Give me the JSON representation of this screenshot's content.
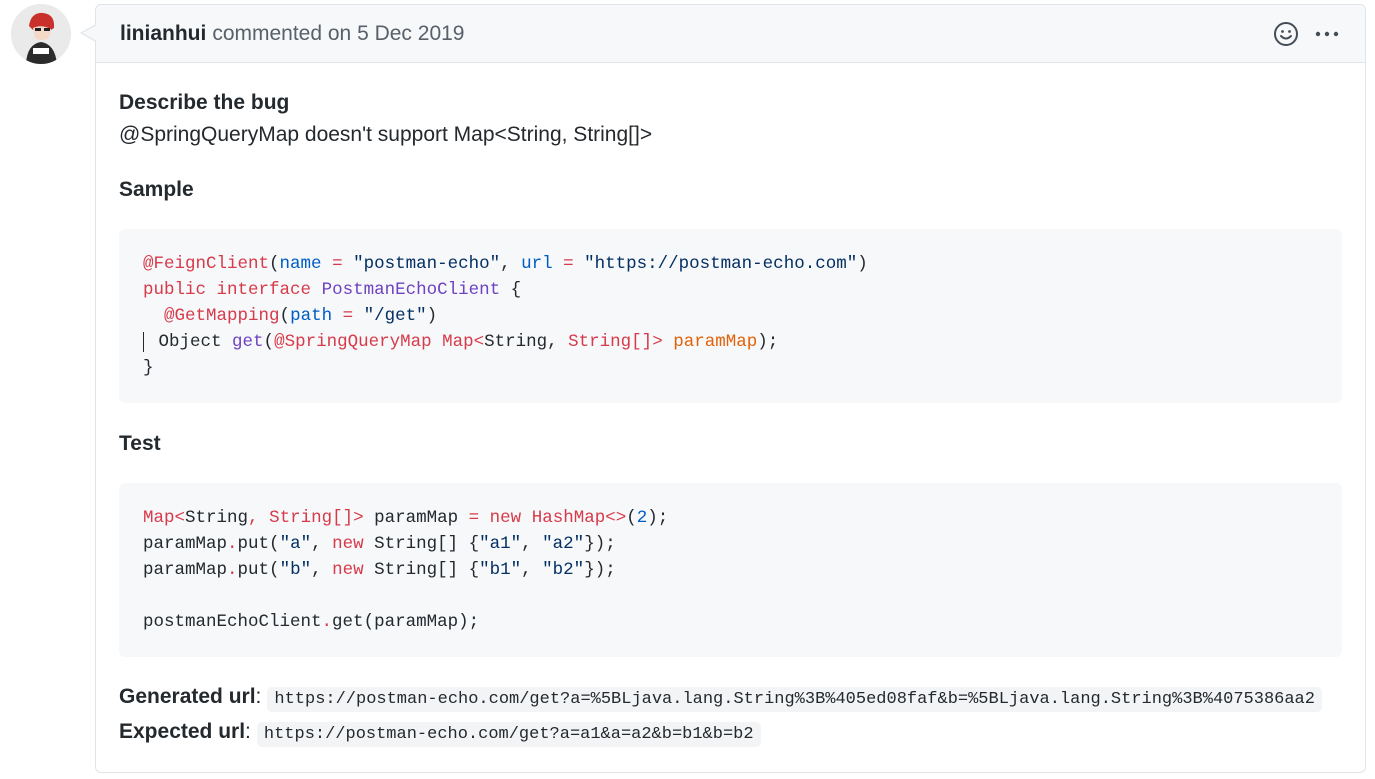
{
  "comment": {
    "author": "linianhui",
    "action_text": "commented on 5 Dec 2019"
  },
  "body": {
    "bug_heading": "Describe the bug",
    "bug_text": "@SpringQueryMap doesn't support Map<String, String[]>",
    "sample_heading": "Sample",
    "sample_code": {
      "l1": {
        "ann": "@FeignClient",
        "p1": "(",
        "a1": "name",
        "eq1": " = ",
        "s1": "\"postman-echo\"",
        "sep": ", ",
        "a2": "url",
        "eq2": " = ",
        "s2": "\"https://postman-echo.com\"",
        "p2": ")"
      },
      "l2": {
        "k1": "public",
        "k2": "interface",
        "cls": "PostmanEchoClient",
        "br": " {"
      },
      "l3": {
        "indent": "  ",
        "ann": "@GetMapping",
        "p1": "(",
        "a1": "path",
        "eq": " = ",
        "s1": "\"/get\"",
        "p2": ")"
      },
      "l4": {
        "t": "Object ",
        "m": "get",
        "p1": "(",
        "ann": "@SpringQueryMap",
        "sp": " ",
        "t1": "Map",
        "lt": "<",
        "t2": "String",
        "cm": ", ",
        "t3": "String[]",
        "gt": ">",
        "sp2": " ",
        "v": "paramMap",
        "p2": ");"
      },
      "l5": {
        "br": "}"
      }
    },
    "test_heading": "Test",
    "test_code": {
      "l1": {
        "t1": "Map",
        "lt": "<",
        "t2": "String",
        "cm": ", ",
        "t3": "String[]",
        "gt": ">",
        "v": " paramMap ",
        "eq": "=",
        "sp": " ",
        "nw": "new",
        "sp2": " ",
        "cls": "HashMap<>",
        "p1": "(",
        "num": "2",
        "p2": ");"
      },
      "l2": {
        "a": "paramMap",
        "dot": ".",
        "m": "put",
        "p": "(",
        "s1": "\"a\"",
        "cm": ", ",
        "nw": "new",
        "rest1": " String[] {",
        "s2": "\"a1\"",
        "cm2": ", ",
        "s3": "\"a2\"",
        "end": "});"
      },
      "l3": {
        "a": "paramMap",
        "dot": ".",
        "m": "put",
        "p": "(",
        "s1": "\"b\"",
        "cm": ", ",
        "nw": "new",
        "rest1": " String[] {",
        "s2": "\"b1\"",
        "cm2": ", ",
        "s3": "\"b2\"",
        "end": "});"
      },
      "l5": {
        "a": "postmanEchoClient",
        "dot": ".",
        "m": "get",
        "end": "(paramMap);"
      }
    },
    "generated_label": "Generated url",
    "generated_url": "https://postman-echo.com/get?a=%5BLjava.lang.String%3B%405ed08faf&b=%5BLjava.lang.String%3B%4075386aa2",
    "expected_label": "Expected url",
    "expected_url": "https://postman-echo.com/get?a=a1&a=a2&b=b1&b=b2",
    "colon": ":"
  },
  "icons": {
    "avatar": "avatar-image",
    "reaction": "smiley-icon",
    "more": "kebab-horizontal-icon"
  }
}
